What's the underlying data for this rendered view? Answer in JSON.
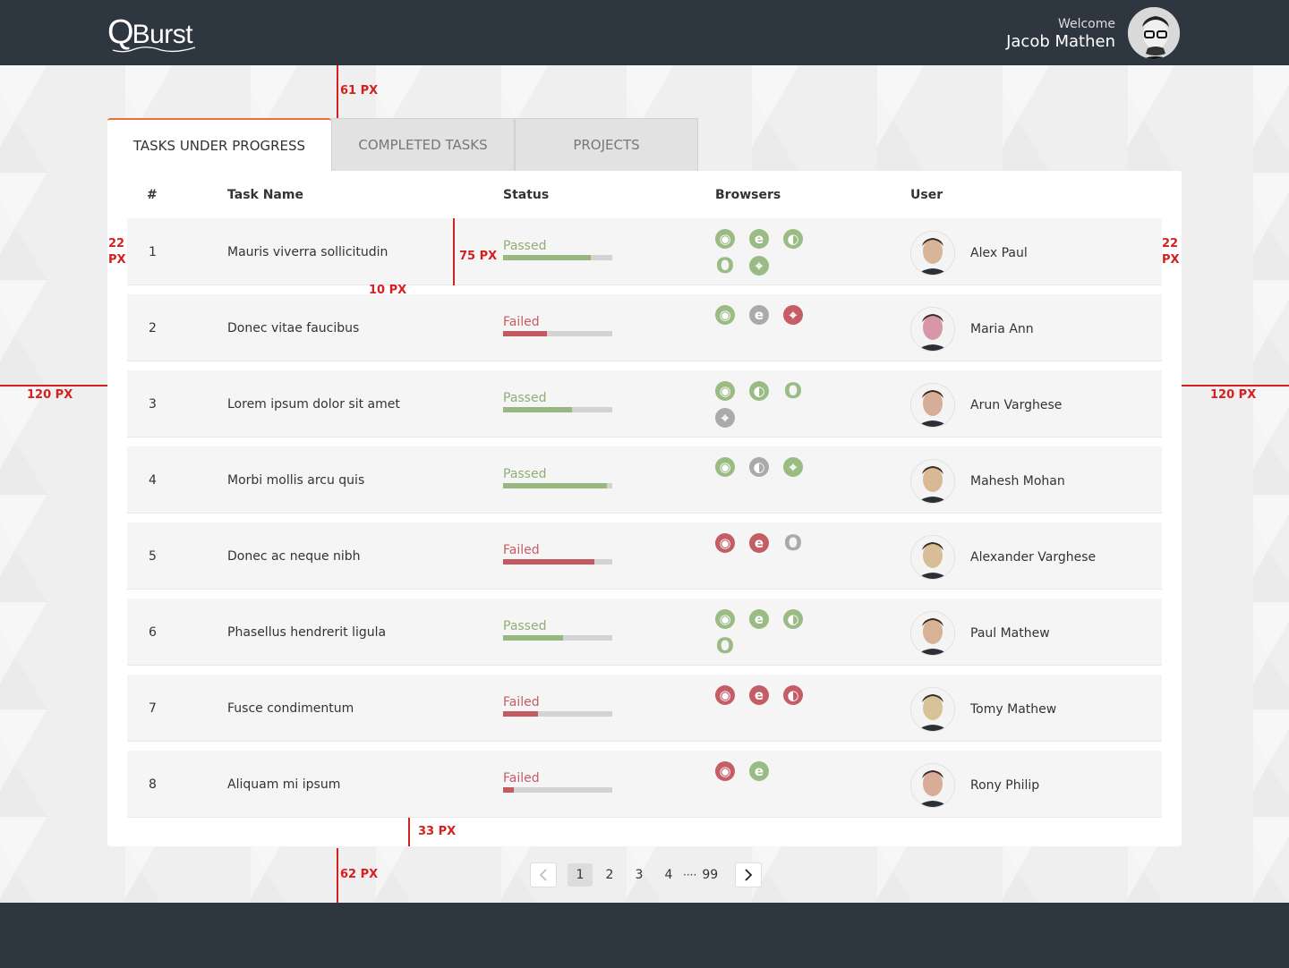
{
  "header": {
    "logo_q": "Q",
    "logo_rest": "Burst",
    "welcome_label": "Welcome",
    "user_name": "Jacob Mathen"
  },
  "tabs": [
    {
      "label": "TASKS UNDER PROGRESS",
      "active": true
    },
    {
      "label": "COMPLETED TASKS",
      "active": false
    },
    {
      "label": "PROJECTS",
      "active": false
    }
  ],
  "table": {
    "columns": [
      "#",
      "Task Name",
      "Status",
      "Browsers",
      "User"
    ],
    "rows": [
      {
        "num": "1",
        "name": "Mauris viverra sollicitudin",
        "status": "Passed",
        "progress": 0.8,
        "browsers": [
          "chrome-icon",
          "ie-icon",
          "firefox-icon",
          "opera-icon",
          "safari-icon"
        ],
        "browser_colors": [
          "#9bbb85",
          "#9bbb85",
          "#9bbb85",
          "#9bbb85",
          "#9bbb85"
        ],
        "user": "Alex Paul"
      },
      {
        "num": "2",
        "name": "Donec vitae faucibus",
        "status": "Failed",
        "progress": 0.4,
        "browsers": [
          "chrome-icon",
          "ie-icon",
          "safari-icon"
        ],
        "browser_colors": [
          "#9bbb85",
          "#aaaaaa",
          "#c45d65"
        ],
        "user": "Maria Ann"
      },
      {
        "num": "3",
        "name": "Lorem ipsum dolor sit amet",
        "status": "Passed",
        "progress": 0.63,
        "browsers": [
          "chrome-icon",
          "firefox-icon",
          "opera-icon",
          "safari-icon"
        ],
        "browser_colors": [
          "#9bbb85",
          "#9bbb85",
          "#9bbb85",
          "#aaaaaa"
        ],
        "user": "Arun Varghese"
      },
      {
        "num": "4",
        "name": "Morbi mollis arcu quis",
        "status": "Passed",
        "progress": 0.95,
        "browsers": [
          "chrome-icon",
          "firefox-icon",
          "safari-icon"
        ],
        "browser_colors": [
          "#9bbb85",
          "#aaaaaa",
          "#9bbb85"
        ],
        "user": "Mahesh Mohan"
      },
      {
        "num": "5",
        "name": "Donec ac neque nibh",
        "status": "Failed",
        "progress": 0.84,
        "browsers": [
          "chrome-icon",
          "ie-icon",
          "opera-icon"
        ],
        "browser_colors": [
          "#c45d65",
          "#c45d65",
          "#aaaaaa"
        ],
        "user": "Alexander Varghese"
      },
      {
        "num": "6",
        "name": "Phasellus hendrerit ligula",
        "status": "Passed",
        "progress": 0.55,
        "browsers": [
          "chrome-icon",
          "ie-icon",
          "firefox-icon",
          "opera-icon"
        ],
        "browser_colors": [
          "#9bbb85",
          "#9bbb85",
          "#9bbb85",
          "#9bbb85"
        ],
        "user": "Paul Mathew"
      },
      {
        "num": "7",
        "name": "Fusce condimentum",
        "status": "Failed",
        "progress": 0.32,
        "browsers": [
          "chrome-icon",
          "ie-icon",
          "firefox-icon"
        ],
        "browser_colors": [
          "#c45d65",
          "#c45d65",
          "#c45d65"
        ],
        "user": "Tomy Mathew"
      },
      {
        "num": "8",
        "name": "Aliquam mi ipsum",
        "status": "Failed",
        "progress": 0.1,
        "browsers": [
          "chrome-icon",
          "ie-icon"
        ],
        "browser_colors": [
          "#c45d65",
          "#9bbb85"
        ],
        "user": "Rony Philip"
      }
    ]
  },
  "pagination": {
    "pages": [
      "1",
      "2",
      "3",
      "4"
    ],
    "dots": "····",
    "last": "99",
    "current": "1"
  },
  "annotations": {
    "top_gap": "61 PX",
    "left_pad_1": "22",
    "left_pad_2": "PX",
    "right_pad_1": "22",
    "right_pad_2": "PX",
    "row_height": "75 PX",
    "row_gap": "10 PX",
    "left_margin": "120 PX",
    "right_margin": "120 PX",
    "bottom_gap": "33 PX",
    "footer_gap": "62 PX"
  },
  "colors": {
    "passed": "#8fae75",
    "failed": "#c45d65",
    "accent": "#e8703a",
    "topbar": "#2e3640"
  }
}
